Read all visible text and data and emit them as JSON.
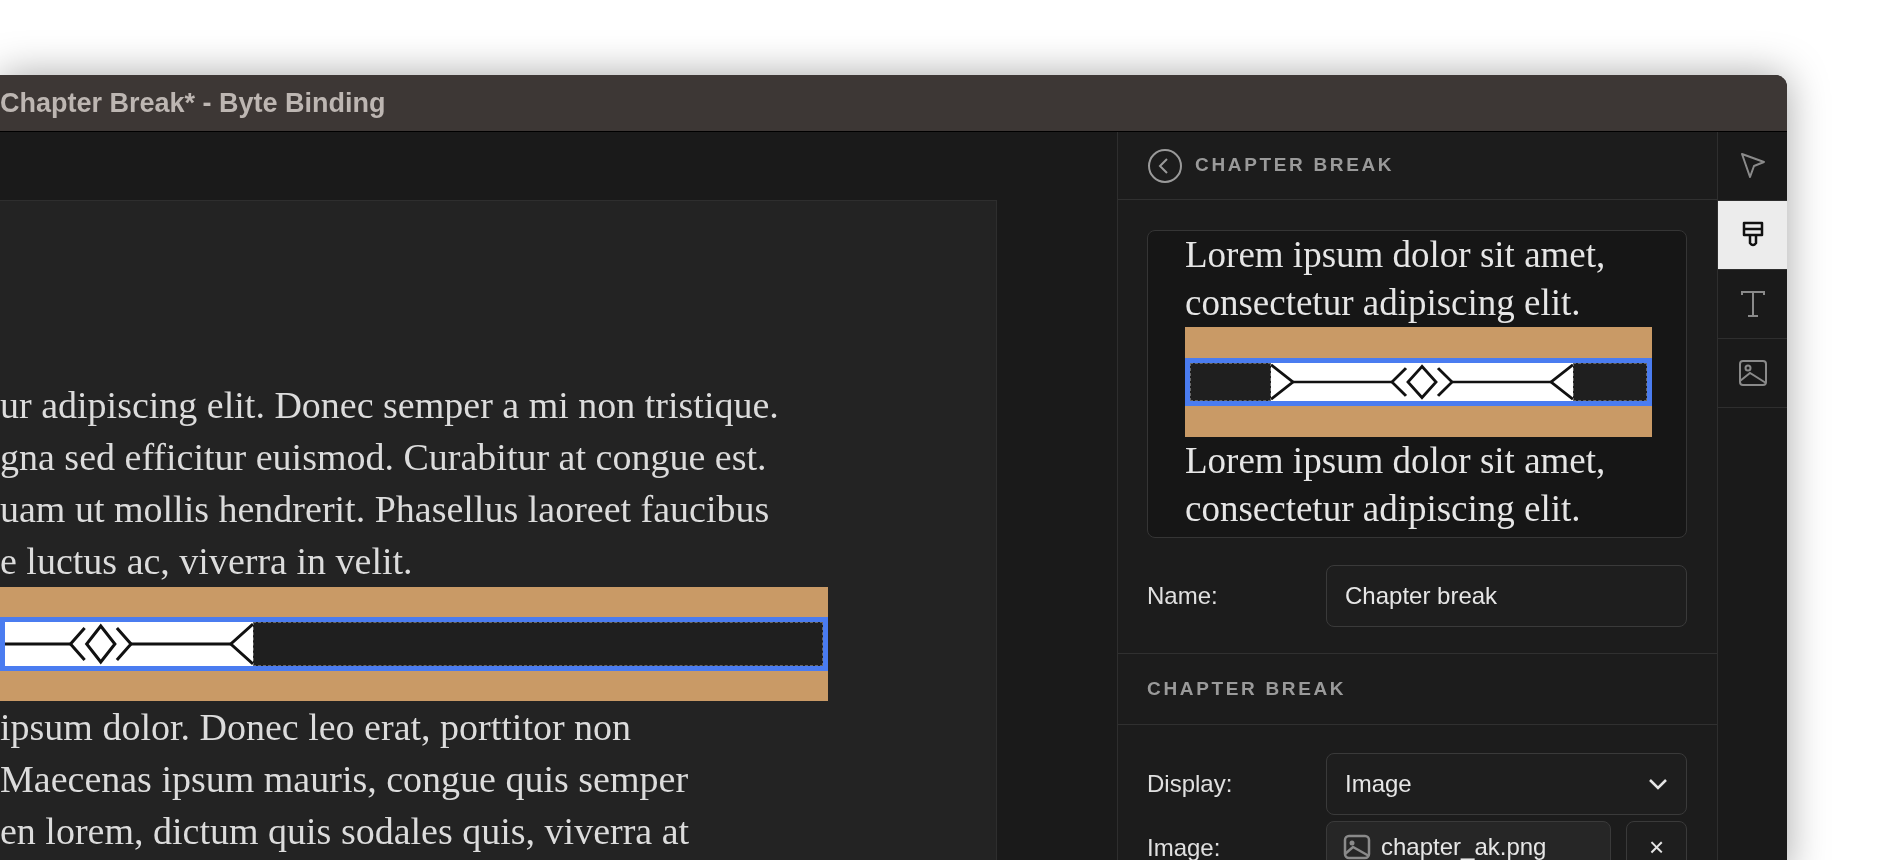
{
  "window": {
    "title": "Chapter Break* - Byte Binding"
  },
  "editor": {
    "lines_before": [
      "ur adipiscing elit. Donec semper a mi non tristique.",
      "gna sed efficitur euismod. Curabitur at congue est.",
      "uam ut mollis hendrerit. Phasellus laoreet faucibus",
      "e luctus ac, viverra in velit."
    ],
    "chapter_break": {
      "selected": true
    },
    "lines_after": [
      "ipsum dolor. Donec leo erat, porttitor non",
      "Maecenas ipsum mauris, congue quis semper",
      "en lorem, dictum quis sodales quis, viverra at"
    ]
  },
  "inspector": {
    "header": {
      "title": "CHAPTER BREAK"
    },
    "preview": {
      "lines_before": [
        "Lorem ipsum dolor sit amet,",
        "consectetur adipiscing elit."
      ],
      "selected": true,
      "lines_after": [
        "Lorem ipsum dolor sit amet,",
        "consectetur adipiscing elit."
      ]
    },
    "name": {
      "label": "Name:",
      "value": "Chapter break"
    },
    "section": {
      "title": "CHAPTER BREAK"
    },
    "display": {
      "label": "Display:",
      "value": "Image"
    },
    "image": {
      "label": "Image:",
      "file": "chapter_ak.png",
      "clear": "×"
    }
  },
  "tools": [
    {
      "kind": "pointer",
      "selected": false
    },
    {
      "kind": "style",
      "selected": true
    },
    {
      "kind": "text",
      "selected": false
    },
    {
      "kind": "image",
      "selected": false
    }
  ]
}
